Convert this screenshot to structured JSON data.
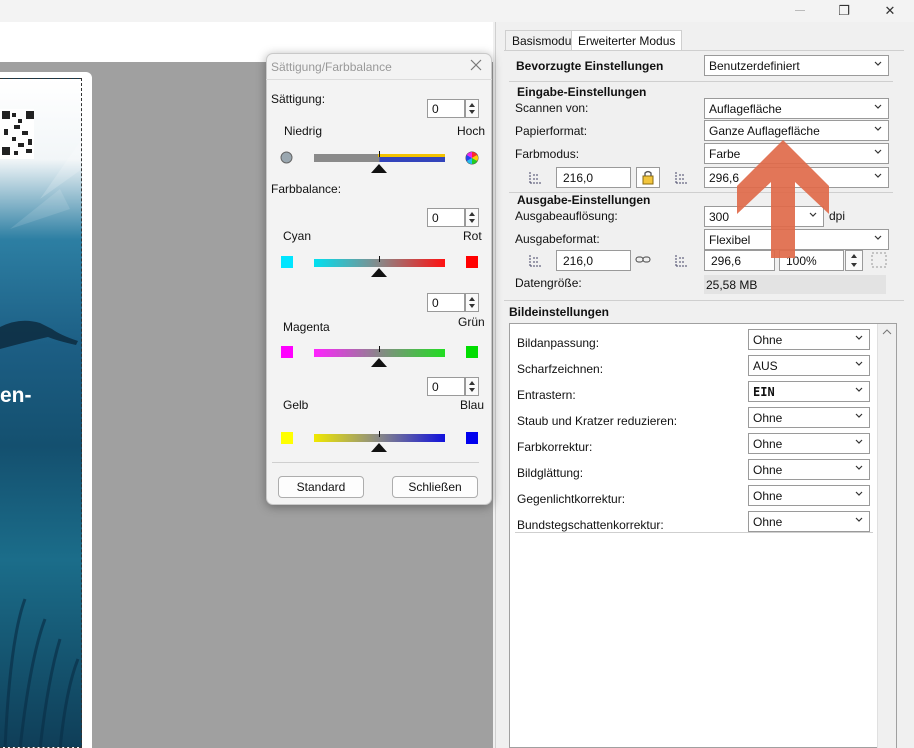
{
  "window": {
    "maximize_glyph": "❐",
    "close_glyph": "✕"
  },
  "preview": {
    "text": "en-"
  },
  "tabs": {
    "basic": "Basismodus",
    "advanced": "Erweiterter Modus"
  },
  "preferred": {
    "label": "Bevorzugte Einstellungen",
    "value": "Benutzerdefiniert"
  },
  "input": {
    "header": "Eingabe-Einstellungen",
    "scan_from_label": "Scannen von:",
    "scan_from_value": "Auflagefläche",
    "paper_label": "Papierformat:",
    "paper_value": "Ganze Auflagefläche",
    "color_label": "Farbmodus:",
    "color_value": "Farbe",
    "width": "216,0",
    "height": "296,6"
  },
  "output": {
    "header": "Ausgabe-Einstellungen",
    "resolution_label": "Ausgabeauflösung:",
    "resolution_value": "300",
    "resolution_unit": "dpi",
    "format_label": "Ausgabeformat:",
    "format_value": "Flexibel",
    "width": "216,0",
    "height": "296,6",
    "scale": "100%",
    "size_label": "Datengröße:",
    "size_value": "25,58 MB"
  },
  "bild": {
    "header": "Bildeinstellungen",
    "rows": [
      {
        "label": "Bildanpassung:",
        "value": "Ohne"
      },
      {
        "label": "Scharfzeichnen:",
        "value": "AUS"
      },
      {
        "label": "Entrastern:",
        "value": "EIN"
      },
      {
        "label": "Staub und Kratzer reduzieren:",
        "value": "Ohne"
      },
      {
        "label": "Farbkorrektur:",
        "value": "Ohne"
      },
      {
        "label": "Bildglättung:",
        "value": "Ohne"
      },
      {
        "label": "Gegenlichtkorrektur:",
        "value": "Ohne"
      },
      {
        "label": "Bundstegschattenkorrektur:",
        "value": "Ohne"
      }
    ]
  },
  "dialog": {
    "title": "Sättigung/Farbbalance",
    "saturation_label": "Sättigung:",
    "saturation_value": "0",
    "sat_low": "Niedrig",
    "sat_high": "Hoch",
    "balance_label": "Farbbalance:",
    "cyan_red_value": "0",
    "cyan": "Cyan",
    "red": "Rot",
    "magenta_green_value": "0",
    "magenta": "Magenta",
    "green": "Grün",
    "yellow_blue_value": "0",
    "yellow": "Gelb",
    "blue": "Blau",
    "standard_button": "Standard",
    "close_button": "Schließen"
  },
  "colors": {
    "arrow": "#e06a4a",
    "cyan": "#00e5ff",
    "red": "#ff0000",
    "magenta": "#ff00ff",
    "green": "#00cc00",
    "yellow": "#ffff00",
    "blue": "#0000ee"
  }
}
